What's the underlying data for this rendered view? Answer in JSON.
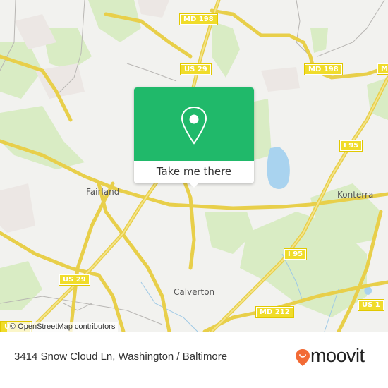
{
  "map": {
    "place_labels": [
      {
        "id": "fairland",
        "text": "Fairland"
      },
      {
        "id": "konterra",
        "text": "Konterra"
      },
      {
        "id": "calverton",
        "text": "Calverton"
      }
    ],
    "road_shields": [
      {
        "id": "md198-top",
        "text": "MD 198"
      },
      {
        "id": "us29-top",
        "text": "US 29"
      },
      {
        "id": "md198-right",
        "text": "MD 198"
      },
      {
        "id": "md198-edge",
        "text": "MD"
      },
      {
        "id": "i95-upper",
        "text": "I 95"
      },
      {
        "id": "i95-lower",
        "text": "I 95"
      },
      {
        "id": "us29-mid",
        "text": "US 29"
      },
      {
        "id": "us29-bottom",
        "text": "US 29"
      },
      {
        "id": "md212-mid",
        "text": "MD 212"
      },
      {
        "id": "md212-bottom",
        "text": "MD 212"
      },
      {
        "id": "us1",
        "text": "US 1"
      }
    ],
    "attribution": "© OpenStreetMap contributors"
  },
  "popup": {
    "icon": "map-pin-icon",
    "action_label": "Take me there",
    "accent_color": "#20b96a"
  },
  "footer": {
    "address": "3414 Snow Cloud Ln, Washington / Baltimore",
    "brand": "moovit",
    "brand_icon": "moovit-logo-icon",
    "brand_color": "#f26a35"
  }
}
